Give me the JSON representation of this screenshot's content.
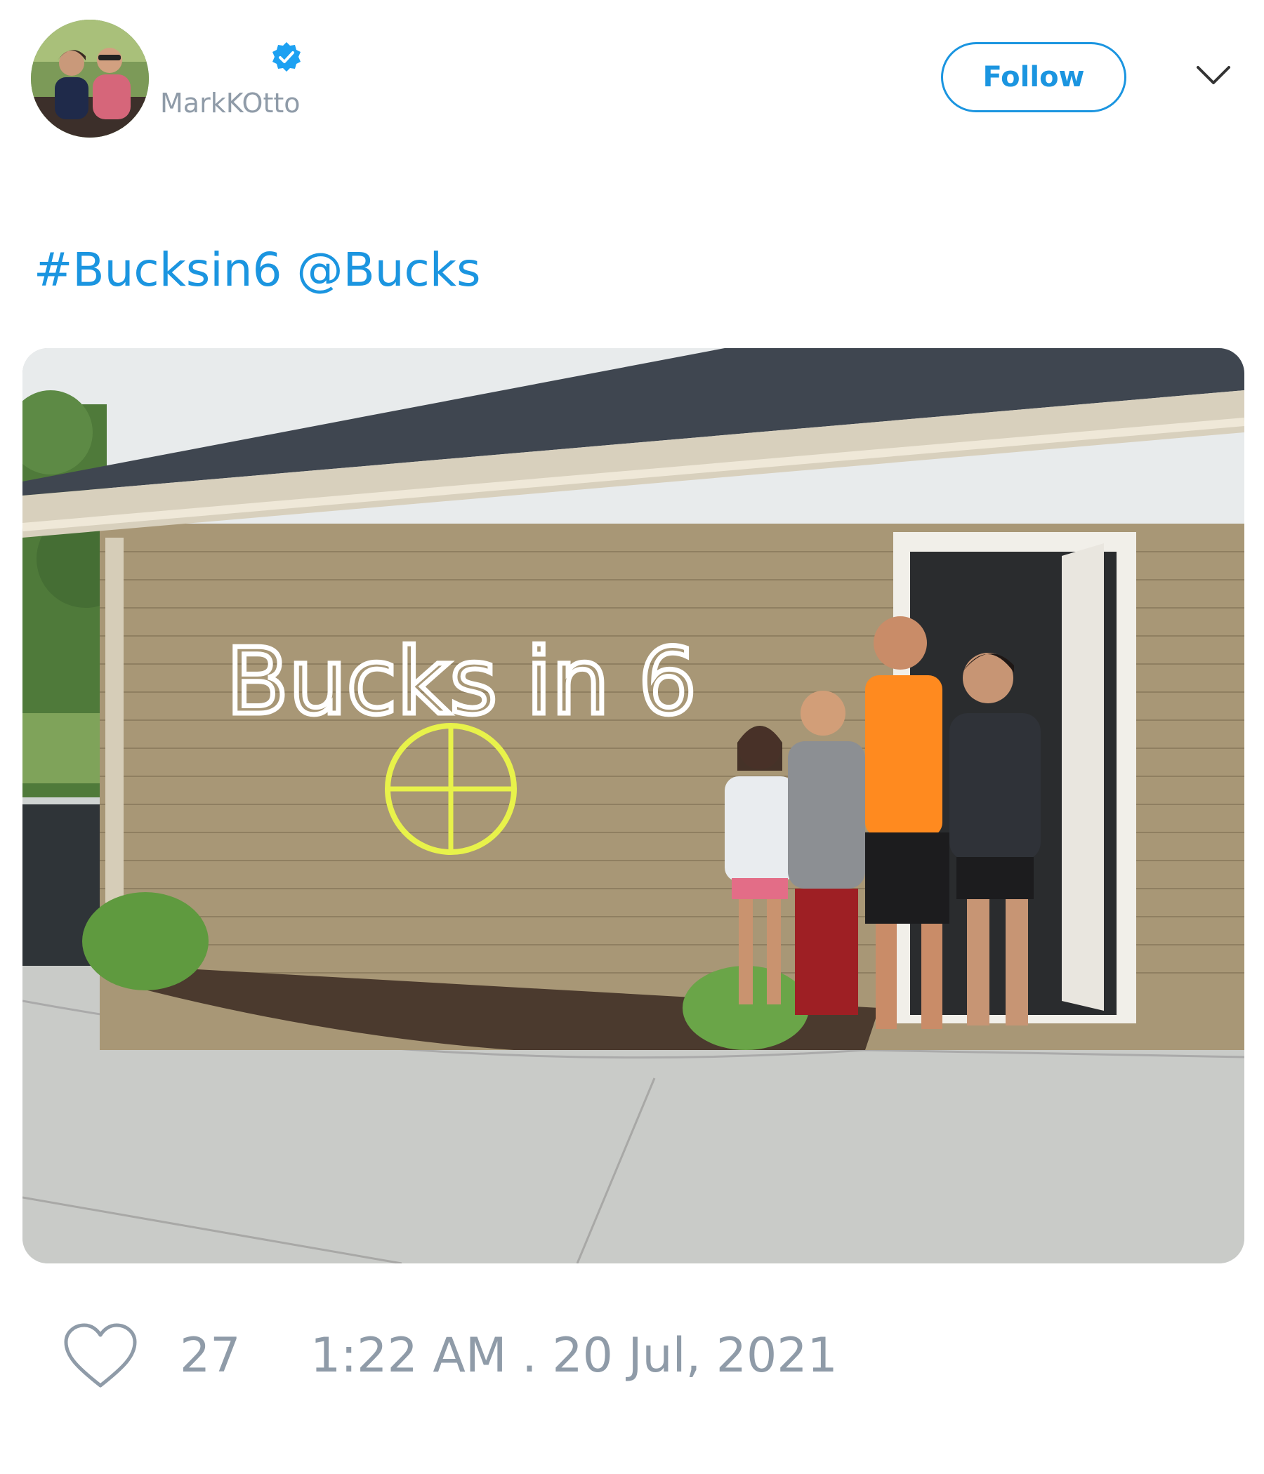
{
  "header": {
    "avatar_icon": "profile-photo",
    "verified_icon": "verified-badge-icon",
    "handle": "MarkKOtto",
    "follow_label": "Follow",
    "menu_icon": "chevron-down-icon"
  },
  "tweet": {
    "hashtag": "#Bucksin6",
    "mention": "@Bucks",
    "photo_graffiti": "Bucks in 6"
  },
  "footer": {
    "like_icon": "heart-icon",
    "like_count": "27",
    "timestamp": "1:22 AM . 20 Jul, 2021"
  },
  "colors": {
    "accent": "#1b95e0",
    "muted": "#8f9ba8"
  }
}
